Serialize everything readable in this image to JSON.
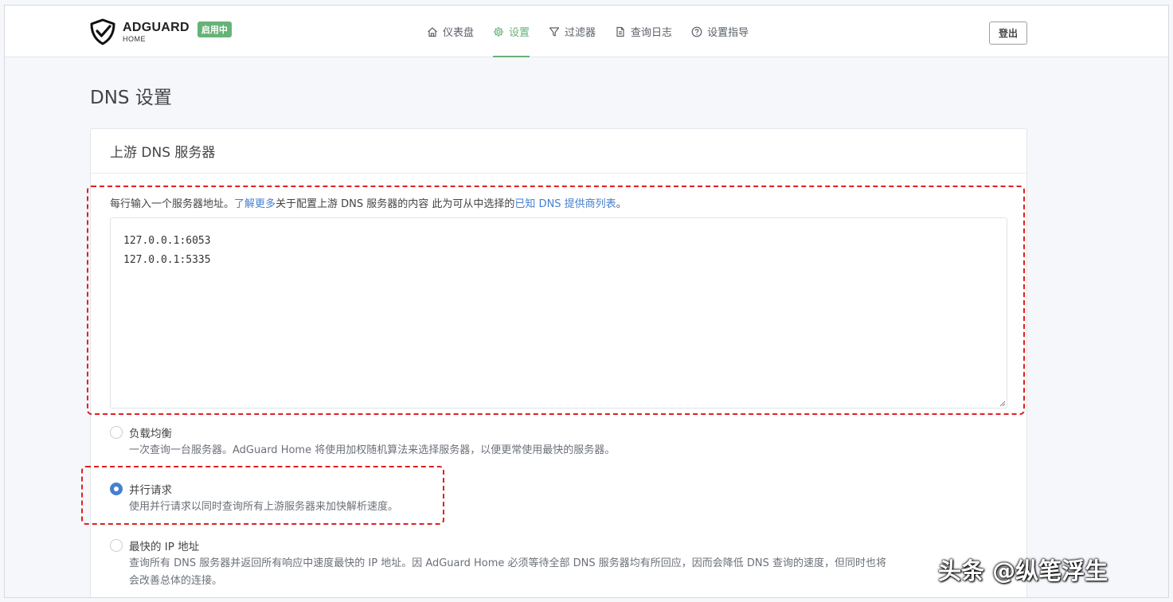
{
  "brand": {
    "name": "ADGUARD",
    "sub": "HOME",
    "status": "启用中"
  },
  "nav": [
    {
      "label": "仪表盘",
      "icon": "home-icon",
      "active": false
    },
    {
      "label": "设置",
      "icon": "gear-icon",
      "active": true
    },
    {
      "label": "过滤器",
      "icon": "filter-icon",
      "active": false
    },
    {
      "label": "查询日志",
      "icon": "document-icon",
      "active": false
    },
    {
      "label": "设置指导",
      "icon": "help-icon",
      "active": false
    }
  ],
  "logout_label": "登出",
  "page_title": "DNS 设置",
  "card": {
    "title": "上游 DNS 服务器",
    "help": {
      "prefix": "每行输入一个服务器地址。",
      "learn_more": "了解更多",
      "middle": "关于配置上游 DNS 服务器的内容 此为可从中选择的",
      "providers_link": "已知 DNS 提供商列表",
      "suffix": "。"
    },
    "upstream_value": "127.0.0.1:6053\n127.0.0.1:5335",
    "options": [
      {
        "label": "负载均衡",
        "desc": "一次查询一台服务器。AdGuard Home 将使用加权随机算法来选择服务器，以便更常使用最快的服务器。",
        "checked": false
      },
      {
        "label": "并行请求",
        "desc": "使用并行请求以同时查询所有上游服务器来加快解析速度。",
        "checked": true
      },
      {
        "label": "最快的 IP 地址",
        "desc": "查询所有 DNS 服务器并返回所有响应中速度最快的 IP 地址。因 AdGuard Home 必须等待全部 DNS 服务器均有所回应，因而会降低 DNS 查询的速度，但同时也将",
        "desc2": "会改善总体的连接。",
        "checked": false
      }
    ]
  },
  "watermark": "头条 @纵笔浮生",
  "colors": {
    "accent_green": "#67b279",
    "link_blue": "#467fcf",
    "highlight_red": "#e02020"
  }
}
